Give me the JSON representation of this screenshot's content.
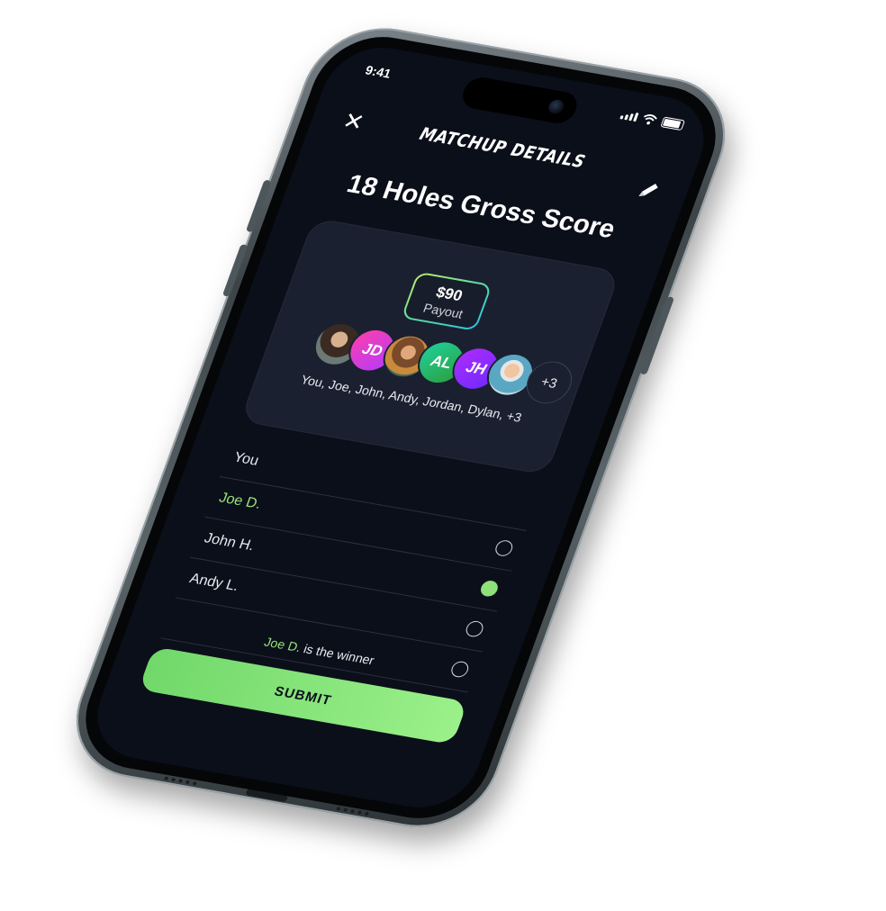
{
  "status": {
    "time": "9:41"
  },
  "header": {
    "close_icon": "✕",
    "title": "MATCHUP DETAILS",
    "edit_icon": "pencil-icon"
  },
  "matchup": {
    "title": "18 Holes Gross Score",
    "payout_amount": "$90",
    "payout_label": "Payout",
    "avatars": [
      {
        "type": "photo",
        "initials": ""
      },
      {
        "type": "initials",
        "initials": "JD"
      },
      {
        "type": "photo",
        "initials": ""
      },
      {
        "type": "initials",
        "initials": "AL"
      },
      {
        "type": "initials",
        "initials": "JH"
      },
      {
        "type": "photo",
        "initials": ""
      }
    ],
    "more_count": "+3",
    "participants_text": "You, Joe, John, Andy, Jordan, Dylan, +3"
  },
  "players": [
    {
      "name": "You",
      "selected": false,
      "has_radio": false
    },
    {
      "name": "Joe D.",
      "selected": false,
      "has_radio": true,
      "highlight": true
    },
    {
      "name": "John H.",
      "selected": true,
      "has_radio": true
    },
    {
      "name": "Andy L.",
      "selected": false,
      "has_radio": true
    },
    {
      "name": "",
      "selected": false,
      "has_radio": true
    }
  ],
  "winner": {
    "name": "Joe D.",
    "suffix": " is the winner"
  },
  "actions": {
    "submit_label": "SUBMIT"
  },
  "colors": {
    "accent": "#8ee07a",
    "background": "#0b0f1a",
    "card": "#1b2030"
  }
}
